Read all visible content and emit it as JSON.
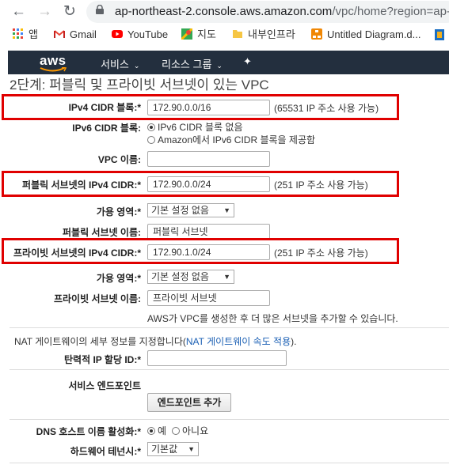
{
  "browser": {
    "url_host": "ap-northeast-2.console.aws.amazon.com",
    "url_path": "/vpc/home?region=ap-no",
    "bookmarks": [
      {
        "label": "앱",
        "icon": "apps-grid-icon"
      },
      {
        "label": "Gmail",
        "icon": "gmail-icon"
      },
      {
        "label": "YouTube",
        "icon": "youtube-icon"
      },
      {
        "label": "지도",
        "icon": "maps-icon"
      },
      {
        "label": "내부인프라",
        "icon": "folder-icon"
      },
      {
        "label": "Untitled Diagram.d...",
        "icon": "drawio-icon"
      }
    ]
  },
  "aws_nav": {
    "logo": "aws",
    "services": "서비스",
    "resource_groups": "리소스 그룹"
  },
  "page": {
    "title": "2단계: 퍼블릭 및 프라이빗 서브넷이 있는 VPC"
  },
  "form": {
    "ipv4_cidr": {
      "label": "IPv4 CIDR 블록:*",
      "value": "172.90.0.0/16",
      "note": "(65531 IP 주소 사용 가능)"
    },
    "ipv6_cidr": {
      "label": "IPv6 CIDR 블록:",
      "option_none": "IPv6 CIDR 블록 없음",
      "option_amazon": "Amazon에서 IPv6 CIDR 블록을 제공함"
    },
    "vpc_name": {
      "label": "VPC 이름:",
      "value": ""
    },
    "public_cidr": {
      "label": "퍼블릭 서브넷의 IPv4 CIDR:*",
      "value": "172.90.0.0/24",
      "note": "(251 IP 주소 사용 가능)"
    },
    "public_az": {
      "label": "가용 영역:*",
      "value": "기본 설정 없음"
    },
    "public_name": {
      "label": "퍼블릭 서브넷 이름:",
      "value": "퍼블릭 서브넷"
    },
    "private_cidr": {
      "label": "프라이빗 서브넷의 IPv4 CIDR:*",
      "value": "172.90.1.0/24",
      "note": "(251 IP 주소 사용 가능)"
    },
    "private_az": {
      "label": "가용 영역:*",
      "value": "기본 설정 없음"
    },
    "private_name": {
      "label": "프라이빗 서브넷 이름:",
      "value": "프라이빗 서브넷"
    },
    "subnet_hint": "AWS가 VPC를 생성한 후 더 많은 서브넷을 추가할 수 있습니다.",
    "nat_text_before": "NAT 게이트웨이의 세부 정보를 지정합니다(",
    "nat_link": "NAT 게이트웨이 속도 적용",
    "nat_text_after": ").",
    "eip": {
      "label": "탄력적 IP 할당 ID:*",
      "value": ""
    },
    "endpoints": {
      "label": "서비스 엔드포인트",
      "button": "엔드포인트 추가"
    },
    "dns": {
      "label": "DNS 호스트 이름 활성화:*",
      "yes": "예",
      "no": "아니요"
    },
    "tenancy": {
      "label": "하드웨어 테넌시:*",
      "value": "기본값"
    }
  }
}
